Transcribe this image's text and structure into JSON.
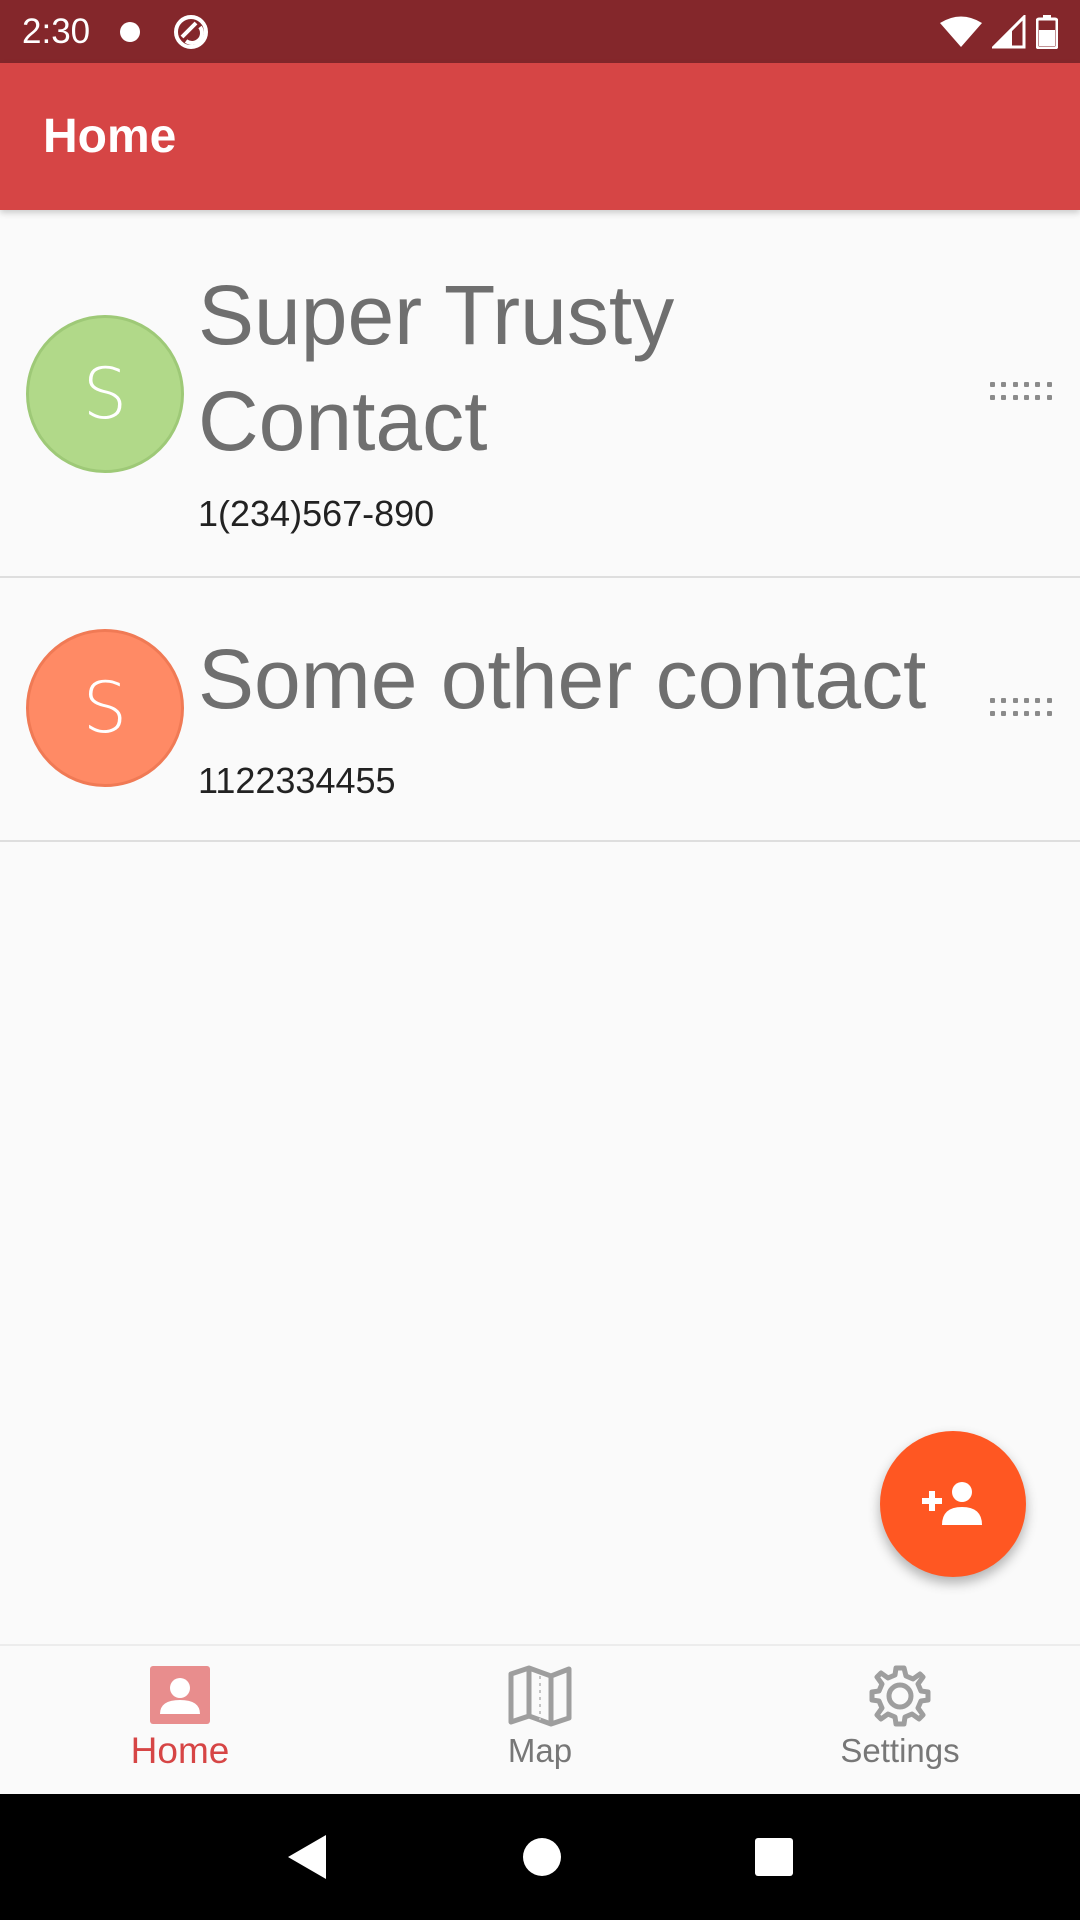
{
  "status_bar": {
    "time": "2:30"
  },
  "app_bar": {
    "title": "Home"
  },
  "contacts": [
    {
      "initial": "S",
      "name_line1": "Super Trusty",
      "name_line2": "Contact",
      "phone": "1(234)567-890",
      "avatar_color": "#b1d989"
    },
    {
      "initial": "S",
      "name": "Some other contact",
      "phone": "1122334455",
      "avatar_color": "#ff8a65"
    }
  ],
  "fab": {
    "icon": "person-add-icon"
  },
  "bottom_nav": {
    "items": [
      {
        "label": "Home",
        "icon": "contact-card-icon",
        "active": true
      },
      {
        "label": "Map",
        "icon": "map-icon",
        "active": false
      },
      {
        "label": "Settings",
        "icon": "gear-icon",
        "active": false
      }
    ]
  },
  "colors": {
    "status_bar": "#84272b",
    "app_bar": "#d64545",
    "fab": "#ff5722",
    "active_nav": "#d64545"
  }
}
